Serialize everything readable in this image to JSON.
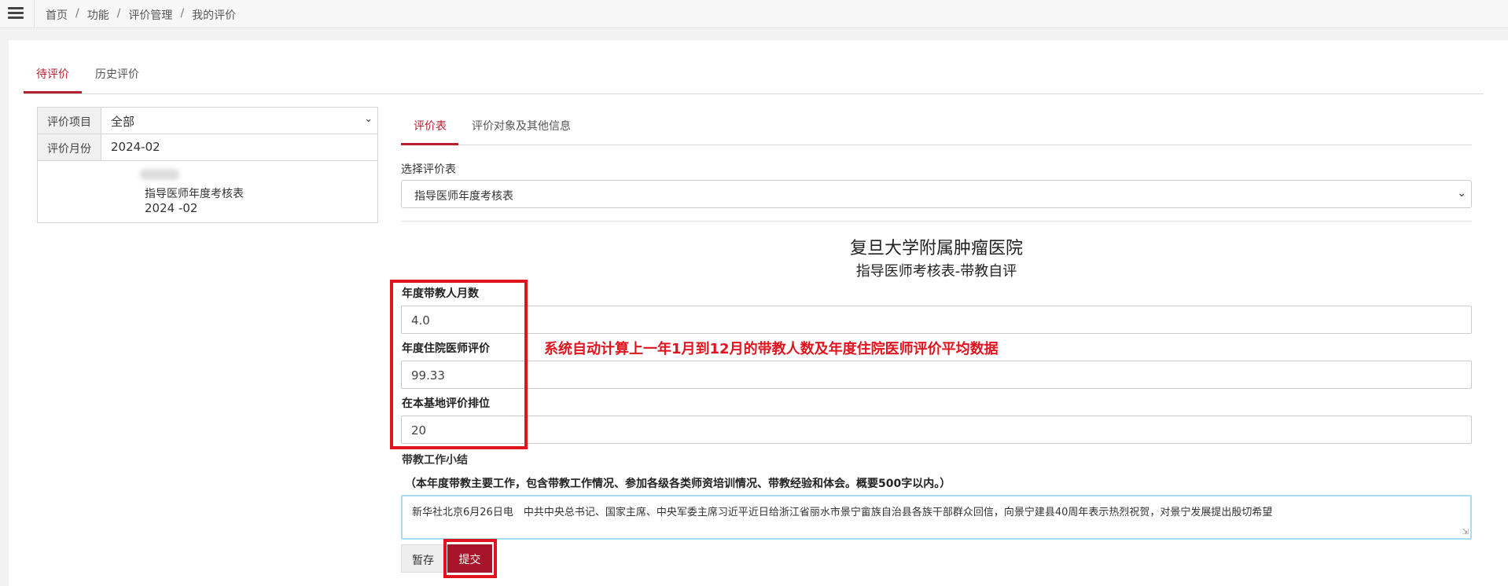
{
  "breadcrumb": [
    "首页",
    "功能",
    "评价管理",
    "我的评价"
  ],
  "breadcrumb_separator": "/",
  "main_tabs": [
    {
      "label": "待评价",
      "active": true
    },
    {
      "label": "历史评价",
      "active": false
    }
  ],
  "left_panel": {
    "project_label": "评价项目",
    "project_value": "全部",
    "month_label": "评价月份",
    "month_value": "2024-02",
    "items": [
      {
        "name": "指导医师年度考核表",
        "month": "2024 -02"
      }
    ]
  },
  "right_tabs": [
    {
      "label": "评价表",
      "active": true
    },
    {
      "label": "评价对象及其他信息",
      "active": false
    }
  ],
  "select_form": {
    "label": "选择评价表",
    "value": "指导医师年度考核表"
  },
  "form": {
    "title": "复旦大学附属肿瘤医院",
    "subtitle": "指导医师考核表-带教自评",
    "fields": [
      {
        "label": "年度带教人月数",
        "value": "4.0"
      },
      {
        "label": "年度住院医师评价",
        "value": "99.33"
      },
      {
        "label": "在本基地评价排位",
        "value": "20"
      }
    ],
    "summary_label": "带教工作小结",
    "summary_hint": "（本年度带教主要工作，包含带教工作情况、参加各级各类师资培训情况、带教经验和体会。概要500字以内。）",
    "summary_value": "新华社北京6月26日电　中共中央总书记、国家主席、中央军委主席习近平近日给浙江省丽水市景宁畲族自治县各族干部群众回信，向景宁建县40周年表示热烈祝贺，对景宁发展提出殷切希望"
  },
  "annotation": "系统自动计算上一年1月到12月的带教人数及年度住院医师评价平均数据",
  "buttons": {
    "save_label": "暂存",
    "submit_label": "提交"
  },
  "colors": {
    "accent": "#b5222e",
    "submit_bg": "#a8142a",
    "highlight_red": "#e0141e"
  }
}
